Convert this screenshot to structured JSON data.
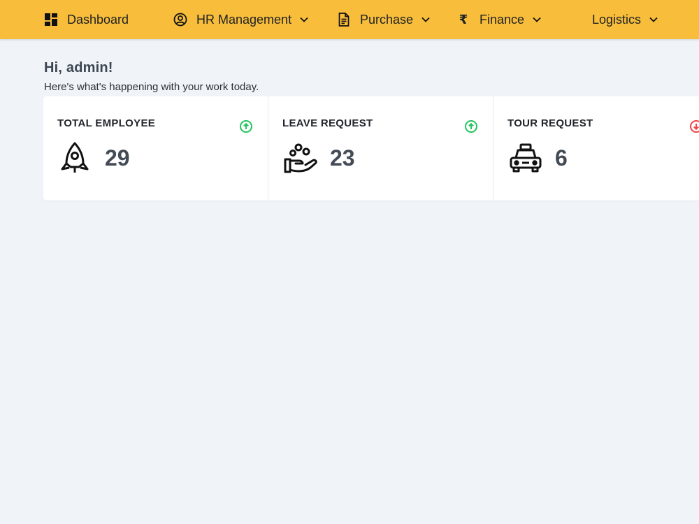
{
  "nav": {
    "dashboard": {
      "label": "Dashboard",
      "icon": "dashboard-grid-icon"
    },
    "hr": {
      "label": "HR Management",
      "icon": "user-circle-icon"
    },
    "purchase": {
      "label": "Purchase",
      "icon": "document-icon"
    },
    "finance": {
      "label": "Finance",
      "icon": "rupee-icon"
    },
    "logistics": {
      "label": "Logistics"
    }
  },
  "greeting": {
    "title": "Hi, admin!",
    "subtitle": "Here's what's happening with your work today."
  },
  "cards": [
    {
      "title": "TOTAL EMPLOYEE",
      "value": "29",
      "icon": "rocket-icon",
      "trend": "up"
    },
    {
      "title": "LEAVE REQUEST",
      "value": "23",
      "icon": "hand-holding-icon",
      "trend": "up"
    },
    {
      "title": "TOUR REQUEST",
      "value": "6",
      "icon": "taxi-icon",
      "trend": "down"
    }
  ],
  "colors": {
    "topbar": "#f7bd3b",
    "background": "#f0f4f8",
    "trend_up": "#22c55e",
    "trend_down": "#ef4444"
  }
}
